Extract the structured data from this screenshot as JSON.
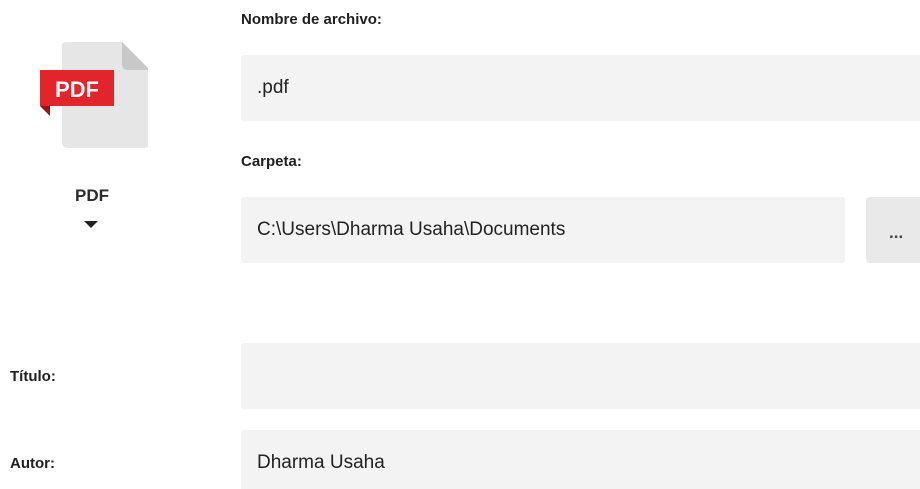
{
  "file_type": {
    "badge_text": "PDF",
    "label": "PDF",
    "icon": "pdf-file-icon",
    "caret_icon": "caret-down-icon",
    "colors": {
      "badge": "#e2242b",
      "badge_fold": "#9e1116",
      "page": "#e6e6e6",
      "page_corner": "#c8c8c8"
    }
  },
  "file_name": {
    "label": "Nombre de archivo:",
    "value": ".pdf"
  },
  "folder": {
    "label": "Carpeta:",
    "value": "C:\\Users\\Dharma Usaha\\Documents",
    "browse_label": "..."
  },
  "title_field": {
    "label": "Título:",
    "value": ""
  },
  "author_field": {
    "label": "Autor:",
    "value": "Dharma Usaha"
  }
}
